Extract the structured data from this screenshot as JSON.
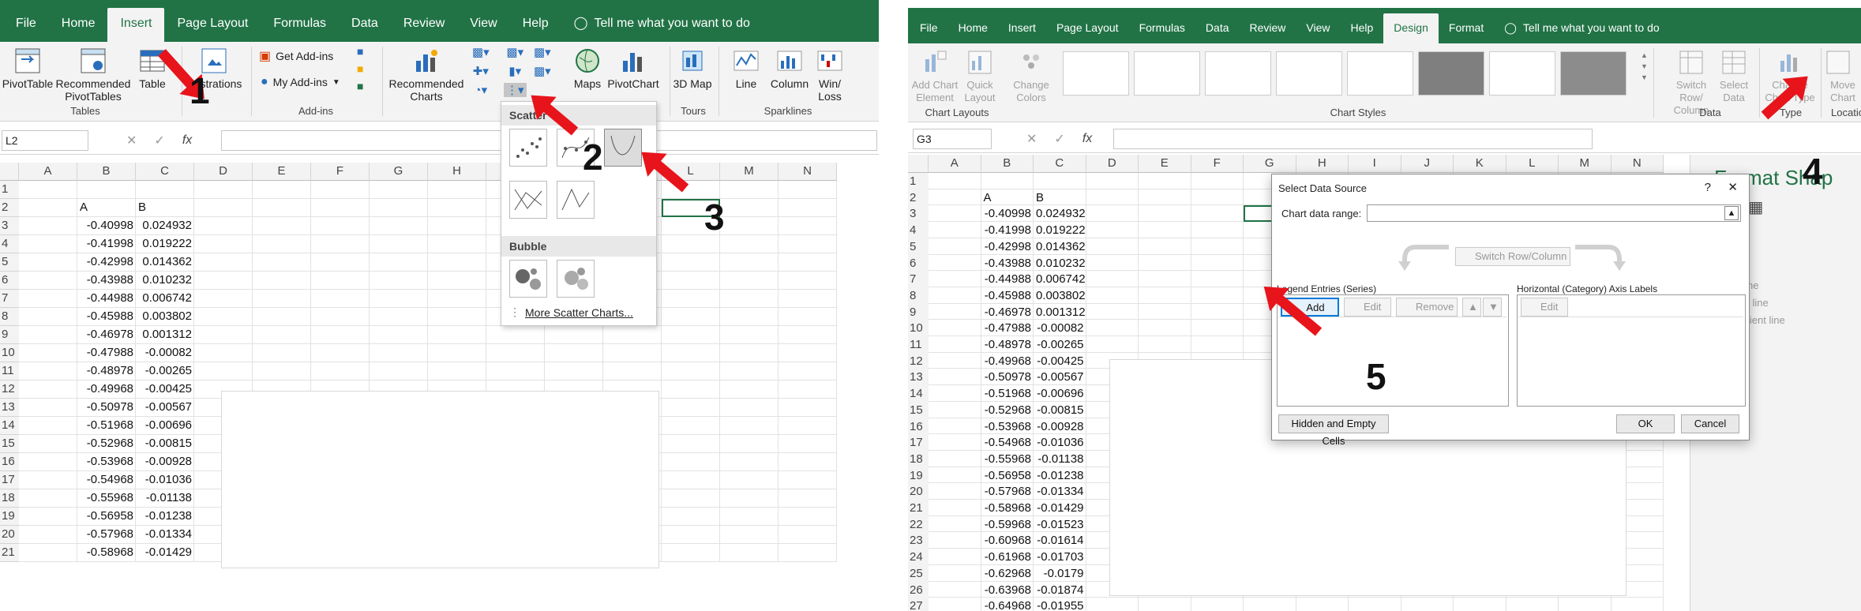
{
  "left": {
    "tabs": [
      "File",
      "Home",
      "Insert",
      "Page Layout",
      "Formulas",
      "Data",
      "Review",
      "View",
      "Help"
    ],
    "active_tab": "Insert",
    "tell_me": "Tell me what you want to do",
    "ribbon": {
      "pivot_table": "PivotTable",
      "recommended_pivot": "Recommended PivotTables",
      "table": "Table",
      "illustrations": "Illustrations",
      "get_addins": "Get Add-ins",
      "my_addins": "My Add-ins",
      "recommended_charts": "Recommended Charts",
      "maps": "Maps",
      "pivot_chart": "PivotChart",
      "map3d": "3D Map",
      "line": "Line",
      "column": "Column",
      "winloss": "Win/ Loss",
      "group_tables": "Tables",
      "group_addins": "Add-ins",
      "group_tours": "Tours",
      "group_sparklines": "Sparklines"
    },
    "name_box": "L2",
    "fx": "fx",
    "columns": [
      "A",
      "B",
      "C",
      "D",
      "E",
      "F",
      "G",
      "H",
      "I",
      "J",
      "K",
      "L",
      "M",
      "N"
    ],
    "rows": [
      "1",
      "2",
      "3",
      "4",
      "5",
      "6",
      "7",
      "8",
      "9",
      "10",
      "11",
      "12",
      "13",
      "14",
      "15",
      "16",
      "17",
      "18",
      "19",
      "20",
      "21"
    ],
    "headers": [
      "A",
      "B"
    ],
    "col_a": [
      "-0.40998",
      "-0.41998",
      "-0.42998",
      "-0.43988",
      "-0.44988",
      "-0.45988",
      "-0.46978",
      "-0.47988",
      "-0.48978",
      "-0.49968",
      "-0.50978",
      "-0.51968",
      "-0.52968",
      "-0.53968",
      "-0.54968",
      "-0.55968",
      "-0.56958",
      "-0.57968",
      "-0.58968"
    ],
    "col_b": [
      "0.024932",
      "0.019222",
      "0.014362",
      "0.010232",
      "0.006742",
      "0.003802",
      "0.001312",
      "-0.00082",
      "-0.00265",
      "-0.00425",
      "-0.00567",
      "-0.00696",
      "-0.00815",
      "-0.00928",
      "-0.01036",
      "-0.01138",
      "-0.01238",
      "-0.01334",
      "-0.01429"
    ],
    "dropdown": {
      "scatter_header": "Scatter",
      "bubble_header": "Bubble",
      "more": "More Scatter Charts..."
    },
    "steps": [
      "1",
      "2",
      "3"
    ]
  },
  "right": {
    "tabs": [
      "File",
      "Home",
      "Insert",
      "Page Layout",
      "Formulas",
      "Data",
      "Review",
      "View",
      "Help",
      "Design",
      "Format"
    ],
    "active_tab": "Design",
    "tell_me": "Tell me what you want to do",
    "ribbon": {
      "add_chart_element": "Add Chart Element",
      "quick_layout": "Quick Layout",
      "change_colors": "Change Colors",
      "switch_row_col": "Switch Row/ Column",
      "select_data": "Select Data",
      "change_chart_type": "Change Chart Type",
      "move_chart": "Move Chart",
      "group_chart_layouts": "Chart Layouts",
      "group_chart_styles": "Chart Styles",
      "group_data": "Data",
      "group_type": "Type",
      "group_location": "Locatio"
    },
    "name_box": "G3",
    "fx": "fx",
    "columns": [
      "A",
      "B",
      "C",
      "D",
      "E",
      "F",
      "G",
      "H",
      "I",
      "J",
      "K",
      "L",
      "M",
      "N"
    ],
    "rows": [
      "1",
      "2",
      "3",
      "4",
      "5",
      "6",
      "7",
      "8",
      "9",
      "10",
      "11",
      "12",
      "13",
      "14",
      "15",
      "16",
      "17",
      "18",
      "19",
      "20",
      "21",
      "22",
      "23",
      "24",
      "25",
      "26",
      "27"
    ],
    "headers": [
      "A",
      "B"
    ],
    "col_a": [
      "-0.40998",
      "-0.41998",
      "-0.42998",
      "-0.43988",
      "-0.44988",
      "-0.45988",
      "-0.46978",
      "-0.47988",
      "-0.48978",
      "-0.49968",
      "-0.50978",
      "-0.51968",
      "-0.52968",
      "-0.53968",
      "-0.54968",
      "-0.55968",
      "-0.56958",
      "-0.57968",
      "-0.58968",
      "-0.59968",
      "-0.60968",
      "-0.61968",
      "-0.62968",
      "-0.63968",
      "-0.64968"
    ],
    "col_b": [
      "0.024932",
      "0.019222",
      "0.014362",
      "0.010232",
      "0.006742",
      "0.003802",
      "0.001312",
      "-0.00082",
      "-0.00265",
      "-0.00425",
      "-0.00567",
      "-0.00696",
      "-0.00815",
      "-0.00928",
      "-0.01036",
      "-0.01138",
      "-0.01238",
      "-0.01334",
      "-0.01429",
      "-0.01523",
      "-0.01614",
      "-0.01703",
      "-0.0179",
      "-0.01874",
      "-0.01955"
    ],
    "dialog": {
      "title": "Select Data Source",
      "help": "?",
      "close": "✕",
      "chart_range_label": "Chart data range:",
      "switch_label": "Switch Row/Column",
      "legend_label": "Legend Entries (Series)",
      "axis_label": "Horizontal (Category) Axis Labels",
      "add": "Add",
      "edit": "Edit",
      "remove": "Remove",
      "axis_edit": "Edit",
      "hidden_cells": "Hidden and Empty Cells",
      "ok": "OK",
      "cancel": "Cancel"
    },
    "side": {
      "format_shape": "Format Shap",
      "id_labels": [
        "ld",
        "ld",
        "ld",
        "ld"
      ],
      "no_line": "No line",
      "solid_line": "Solid line",
      "gradient_line": "Gradient line"
    },
    "steps": [
      "4",
      "5"
    ]
  },
  "colors": {
    "excel_green": "#217346",
    "arrow_red": "#e8141b"
  }
}
